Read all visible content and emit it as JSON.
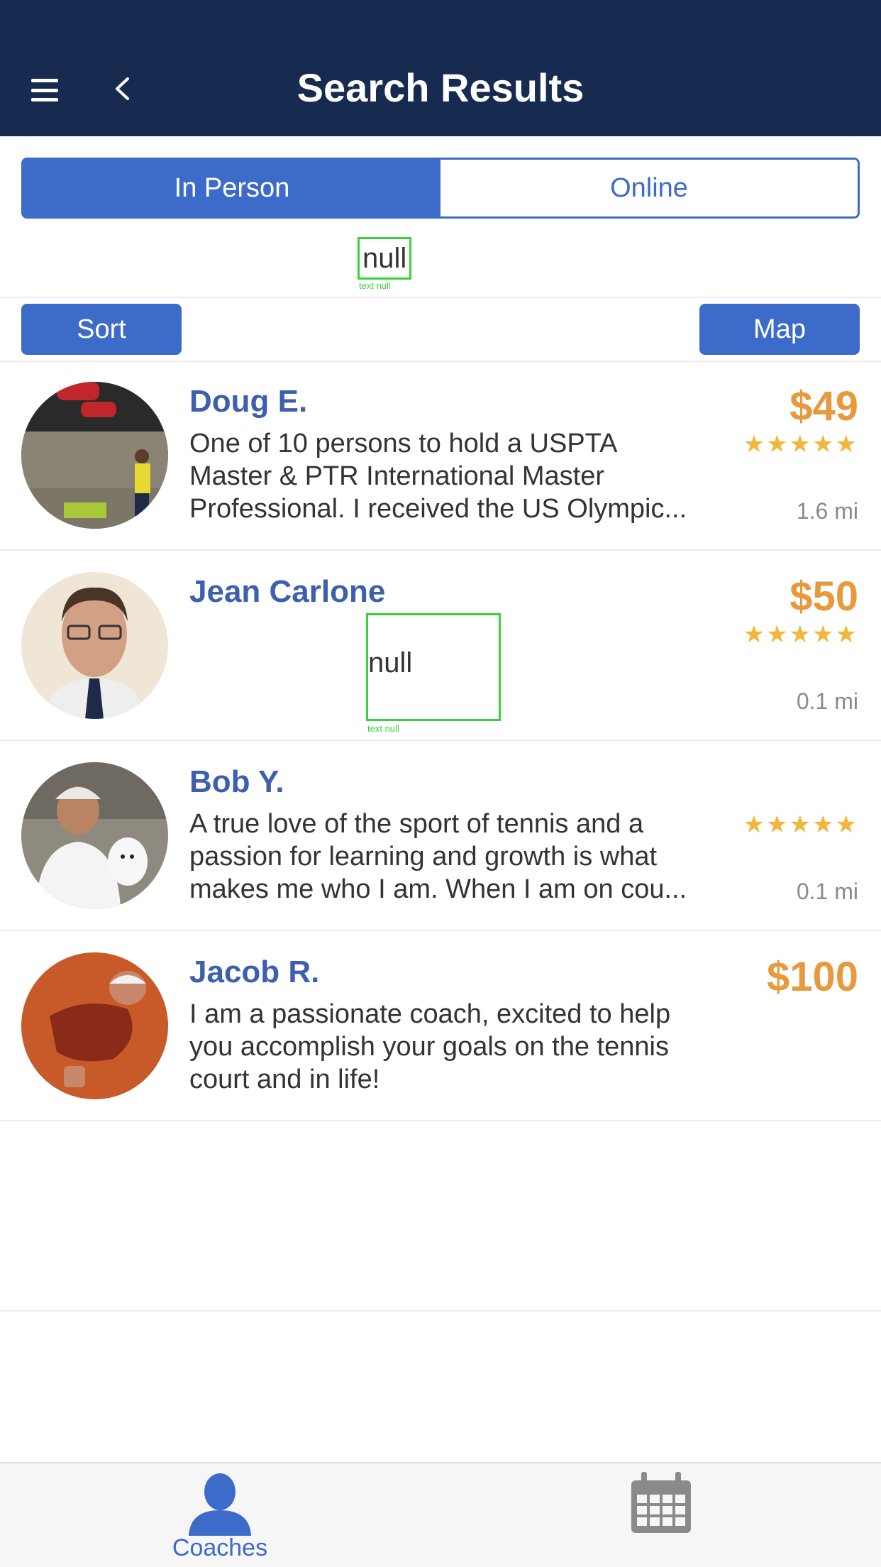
{
  "header": {
    "title": "Search Results",
    "background": "#172b50"
  },
  "segments": {
    "active": "In Person",
    "inactive": "Online"
  },
  "placeholder_text": "null",
  "placeholder_caption": "text null",
  "toolbar": {
    "sort_label": "Sort",
    "map_label": "Map"
  },
  "coaches": [
    {
      "name": "Doug E.",
      "bio_lines": [
        "One of 10 persons to hold a USPTA",
        "Master & PTR International Master",
        "Professional. I received the US Olympic..."
      ],
      "price": "$49",
      "rating": "★★★★★",
      "distance": "1.6 mi"
    },
    {
      "name": "Jean Carlone",
      "bio_lines": [],
      "price": "$50",
      "rating": "★★★★★",
      "distance": "0.1 mi"
    },
    {
      "name": "Bob Y.",
      "bio_lines": [
        "A true love of the sport of tennis and a",
        "passion for learning and growth is what",
        "makes me who I am.  When I am on cou..."
      ],
      "price": "",
      "rating": "★★★★★",
      "distance": "0.1 mi"
    },
    {
      "name": "Jacob R.",
      "bio_lines": [
        "I am a passionate coach, excited to help",
        "you accomplish your goals on the tennis",
        "court and in life!"
      ],
      "price": "$100",
      "rating": "",
      "distance": ""
    }
  ],
  "tabbar": {
    "coaches_label": "Coaches",
    "coaches_icon": "person-icon",
    "calendar_icon": "calendar-icon"
  },
  "colors": {
    "accent": "#3c6bc9",
    "name": "#3c5fae",
    "price": "#e69a3c",
    "stars": "#f2b63c"
  }
}
